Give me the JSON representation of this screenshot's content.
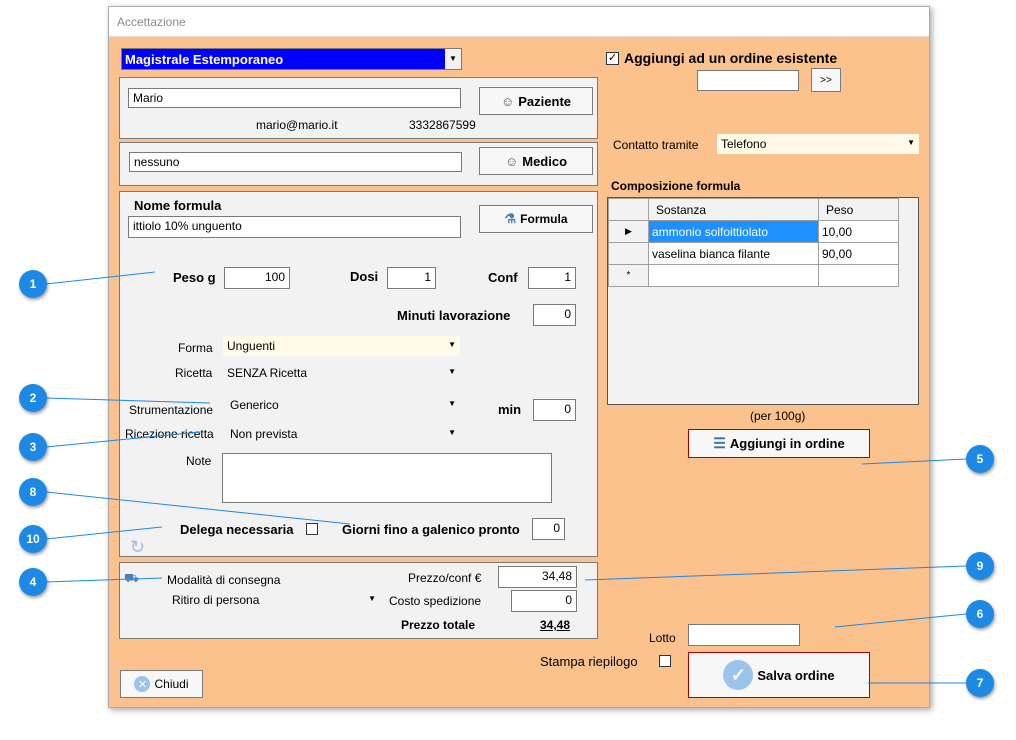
{
  "window": {
    "title": "Accettazione"
  },
  "type_select": {
    "value": "Magistrale Estemporaneo"
  },
  "add_existing": {
    "label": "Aggiungi ad un ordine esistente",
    "go_label": ">>"
  },
  "patient": {
    "name": "Mario",
    "email": "mario@mario.it",
    "phone": "3332867599",
    "button": "Paziente"
  },
  "doctor": {
    "name": "nessuno",
    "button": "Medico"
  },
  "contact": {
    "label": "Contatto tramite",
    "value": "Telefono"
  },
  "composition": {
    "title": "Composizione formula",
    "headers": [
      "Sostanza",
      "Peso"
    ],
    "rows": [
      {
        "marker": "▶",
        "name": "ammonio solfoittiolato",
        "weight": "10,00"
      },
      {
        "marker": "",
        "name": "vaselina bianca filante",
        "weight": "90,00"
      }
    ],
    "new_marker": "*",
    "note": "(per 100g)"
  },
  "add_order_button": "Aggiungi in ordine",
  "formula": {
    "label": "Nome formula",
    "value": "ittiolo 10% unguento",
    "button": "Formula",
    "peso_label": "Peso g",
    "peso": "100",
    "dosi_label": "Dosi",
    "dosi": "1",
    "conf_label": "Conf",
    "conf": "1",
    "minuti_label": "Minuti lavorazione",
    "minuti": "0",
    "forma_label": "Forma",
    "forma": "Unguenti",
    "ricetta_label": "Ricetta",
    "ricetta": "SENZA Ricetta",
    "strum_label": "Strumentazione",
    "strum": "Generico",
    "min_label": "min",
    "min": "0",
    "ricezione_label": "Ricezione ricetta",
    "ricezione": "Non prevista",
    "note_label": "Note",
    "note": "",
    "delega_label": "Delega necessaria",
    "giorni_label": "Giorni fino a galenico pronto",
    "giorni": "0"
  },
  "delivery": {
    "mode_label": "Modalità di consegna",
    "mode": "Ritiro di persona",
    "prezzo_label": "Prezzo/conf €",
    "prezzo": "34,48",
    "spedizione_label": "Costo spedizione",
    "spedizione": "0",
    "totale_label": "Prezzo totale",
    "totale": "34,48"
  },
  "lotto": {
    "label": "Lotto",
    "value": ""
  },
  "stampa_label": "Stampa riepilogo",
  "save_button": "Salva ordine",
  "close_button": "Chiudi",
  "callouts": {
    "c1": "1",
    "c2": "2",
    "c3": "3",
    "c4": "4",
    "c5": "5",
    "c6": "6",
    "c7": "7",
    "c8": "8",
    "c9": "9",
    "c10": "10"
  },
  "colors": {
    "window_bg": "#fcc28e",
    "panel_bg": "#f2f2f2",
    "selected_bg": "#1e90ff",
    "callout": "#1e88e5",
    "select_highlight": "#0000ff"
  }
}
